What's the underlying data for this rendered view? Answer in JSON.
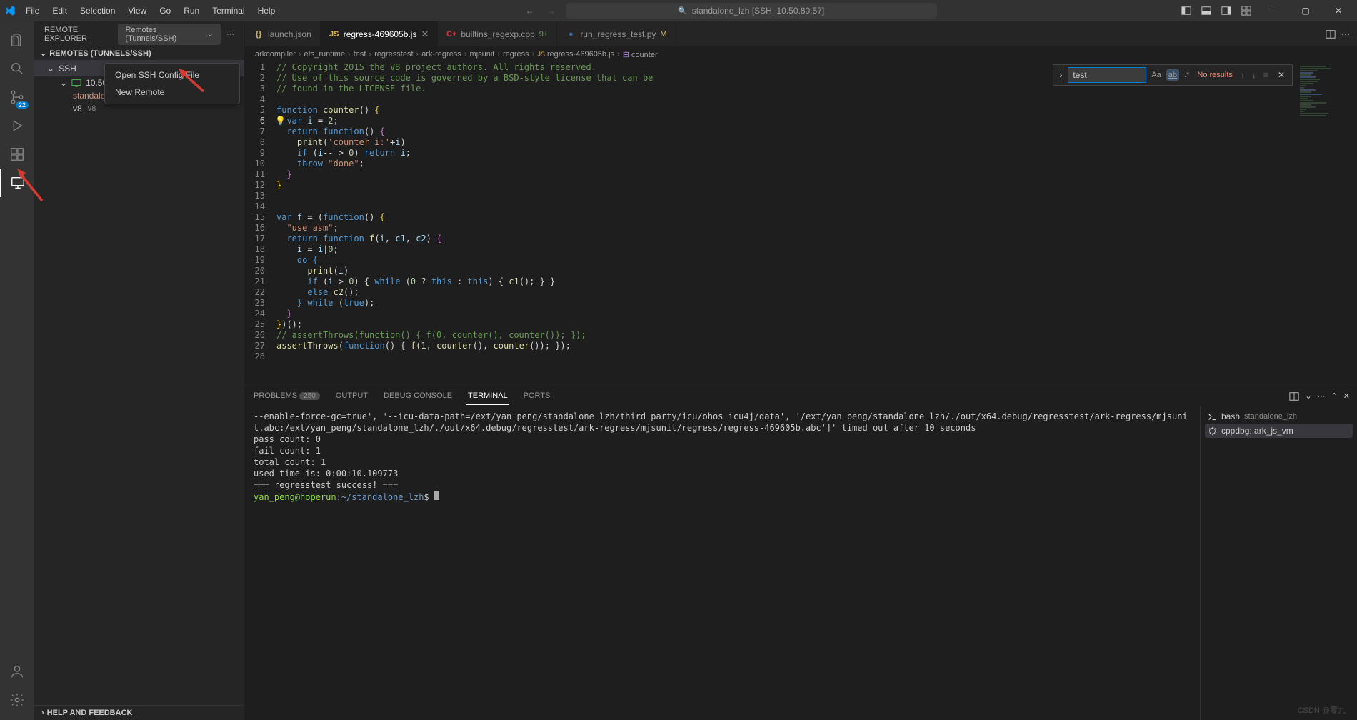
{
  "title": "standalone_lzh [SSH: 10.50.80.57]",
  "menubar": [
    "File",
    "Edit",
    "Selection",
    "View",
    "Go",
    "Run",
    "Terminal",
    "Help"
  ],
  "activity_badge": "22",
  "sidebar": {
    "title": "REMOTE EXPLORER",
    "dropdown": "Remotes (Tunnels/SSH)",
    "section": "REMOTES (TUNNELS/SSH)",
    "ssh_label": "SSH",
    "host": "10.50.80.5",
    "children": [
      {
        "label": "standalone_",
        "sub": ""
      },
      {
        "label": "v8",
        "sub": "v8"
      }
    ],
    "footer": "HELP AND FEEDBACK"
  },
  "context_menu": {
    "items": [
      "Open SSH Config File",
      "New Remote"
    ]
  },
  "tabs": [
    {
      "icon": "{}",
      "iconColor": "#d7ba7d",
      "label": "launch.json",
      "active": false,
      "suffix": ""
    },
    {
      "icon": "JS",
      "iconColor": "#e4b33a",
      "label": "regress-469605b.js",
      "active": true,
      "suffix": "",
      "close": true
    },
    {
      "icon": "C+",
      "iconColor": "#cc3e44",
      "label": "builtins_regexp.cpp",
      "active": false,
      "suffix": "9+",
      "suffixColor": "#6a9955"
    },
    {
      "icon": "●",
      "iconColor": "#3572A5",
      "label": "run_regress_test.py",
      "active": false,
      "suffix": "M",
      "suffixColor": "#d7ba7d"
    }
  ],
  "breadcrumbs": [
    "arkcompiler",
    "ets_runtime",
    "test",
    "regresstest",
    "ark-regress",
    "mjsunit",
    "regress",
    "regress-469605b.js",
    "counter"
  ],
  "find": {
    "value": "test",
    "results": "No results"
  },
  "code": {
    "start": 1,
    "lines": [
      {
        "t": "// Copyright 2015 the V8 project authors. All rights reserved.",
        "c": "comment"
      },
      {
        "t": "// Use of this source code is governed by a BSD-style license that can be",
        "c": "comment"
      },
      {
        "t": "// found in the LICENSE file.",
        "c": "comment"
      },
      {
        "t": ""
      },
      {
        "raw": "<span class='tok-keyword'>function</span> <span class='tok-fn'>counter</span>() <span class='tok-par'>{</span>"
      },
      {
        "raw": "  <span class='tok-keyword'>var</span> <span class='tok-var'>i</span> = <span class='tok-num'>2</span>;"
      },
      {
        "raw": "  <span class='tok-keyword'>return</span> <span class='tok-keyword'>function</span>() <span class='tok-par2'>{</span>"
      },
      {
        "raw": "    <span class='tok-fn'>print</span>(<span class='tok-str'>'counter i:'</span>+<span class='tok-var'>i</span>)"
      },
      {
        "raw": "    <span class='tok-keyword'>if</span> (<span class='tok-var'>i</span>-- &gt; <span class='tok-num'>0</span>) <span class='tok-keyword'>return</span> <span class='tok-var'>i</span>;"
      },
      {
        "raw": "    <span class='tok-keyword'>throw</span> <span class='tok-str'>\"done\"</span>;"
      },
      {
        "raw": "  <span class='tok-par2'>}</span>"
      },
      {
        "raw": "<span class='tok-par'>}</span>"
      },
      {
        "t": ""
      },
      {
        "t": ""
      },
      {
        "raw": "<span class='tok-keyword'>var</span> <span class='tok-var'>f</span> = (<span class='tok-keyword'>function</span>() <span class='tok-par'>{</span>"
      },
      {
        "raw": "  <span class='tok-str'>\"use asm\"</span>;"
      },
      {
        "raw": "  <span class='tok-keyword'>return</span> <span class='tok-keyword'>function</span> <span class='tok-fn'>f</span>(<span class='tok-var'>i</span>, <span class='tok-var'>c1</span>, <span class='tok-var'>c2</span>) <span class='tok-par2'>{</span>"
      },
      {
        "raw": "    <span class='tok-var'>i</span> = <span class='tok-var'>i</span>|<span class='tok-num'>0</span>;"
      },
      {
        "raw": "    <span class='tok-keyword'>do</span> <span class='tok-par3'>{</span>"
      },
      {
        "raw": "      <span class='tok-fn'>print</span>(<span class='tok-var'>i</span>)"
      },
      {
        "raw": "      <span class='tok-keyword'>if</span> (<span class='tok-var'>i</span> &gt; <span class='tok-num'>0</span>) { <span class='tok-keyword'>while</span> (<span class='tok-num'>0</span> ? <span class='tok-keyword'>this</span> : <span class='tok-keyword'>this</span>) { <span class='tok-fn'>c1</span>(); } }"
      },
      {
        "raw": "      <span class='tok-keyword'>else</span> <span class='tok-fn'>c2</span>();"
      },
      {
        "raw": "    <span class='tok-par3'>}</span> <span class='tok-keyword'>while</span> (<span class='tok-const'>true</span>);"
      },
      {
        "raw": "  <span class='tok-par2'>}</span>"
      },
      {
        "raw": "<span class='tok-par'>}</span>)();"
      },
      {
        "raw": "<span class='tok-comment'>// assertThrows(function() { f(0, counter(), counter()); });</span>"
      },
      {
        "raw": "<span class='tok-fn'>assertThrows</span>(<span class='tok-keyword'>function</span>() { <span class='tok-fn'>f</span>(<span class='tok-num'>1</span>, <span class='tok-fn'>counter</span>(), <span class='tok-fn'>counter</span>()); });"
      },
      {
        "t": ""
      }
    ]
  },
  "panel": {
    "tabs": [
      {
        "label": "PROBLEMS",
        "badge": "250"
      },
      {
        "label": "OUTPUT"
      },
      {
        "label": "DEBUG CONSOLE"
      },
      {
        "label": "TERMINAL",
        "active": true
      },
      {
        "label": "PORTS"
      }
    ]
  },
  "terminal_lines": [
    "--enable-force-gc=true', '--icu-data-path=/ext/yan_peng/standalone_lzh/third_party/icu/ohos_icu4j/data', '/ext/yan_peng/standalone_lzh/./out/x64.debug/regresstest/ark-regress/mjsunit.abc:/ext/yan_peng/standalone_lzh/./out/x64.debug/regresstest/ark-regress/mjsunit/regress/regress-469605b.abc']' timed out after 10 seconds",
    "",
    "",
    "pass count: 0",
    "",
    "fail count: 1",
    "",
    "total count: 1",
    "",
    "used time is: 0:00:10.109773",
    "",
    "",
    "=== regresstest success! ===",
    ""
  ],
  "terminal_prompt": {
    "user": "yan_peng@hoperun",
    "path": "~/standalone_lzh",
    "suffix": "$"
  },
  "term_side": [
    {
      "icon": "bash",
      "main": "bash",
      "sub": "standalone_lzh"
    },
    {
      "icon": "bug",
      "main": "cppdbg: ark_js_vm",
      "sub": "",
      "selected": true
    }
  ],
  "watermark": "CSDN @零九"
}
